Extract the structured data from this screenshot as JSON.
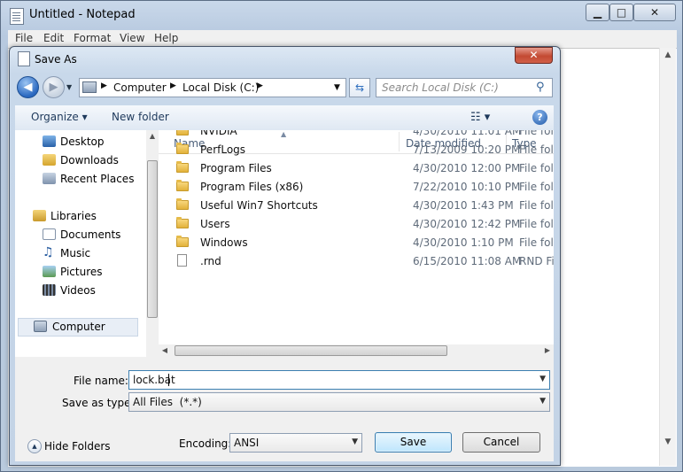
{
  "notepad": {
    "title": "Untitled - Notepad",
    "menu": [
      "File",
      "Edit",
      "Format",
      "View",
      "Help"
    ],
    "minimize": "▁",
    "maximize": "□",
    "close": "✕"
  },
  "dialog": {
    "title": "Save As",
    "close": "✕",
    "address": {
      "segments": [
        "Computer",
        "Local Disk (C:)"
      ]
    },
    "search_placeholder": "Search Local Disk (C:)",
    "toolbar": {
      "organize": "Organize ▾",
      "new_folder": "New folder",
      "help": "?"
    },
    "nav_pane": {
      "favorites": [
        "Desktop",
        "Downloads",
        "Recent Places"
      ],
      "libraries_header": "Libraries",
      "libraries": [
        "Documents",
        "Music",
        "Pictures",
        "Videos"
      ],
      "computer": "Computer"
    },
    "columns": {
      "name": "Name",
      "date_modified": "Date modified",
      "type": "Type"
    },
    "files": [
      {
        "name": "NVIDIA",
        "date": "4/30/2010 11:01 AM",
        "type": "File folder",
        "kind": "folder"
      },
      {
        "name": "PerfLogs",
        "date": "7/13/2009 10:20 PM",
        "type": "File folder",
        "kind": "folder"
      },
      {
        "name": "Program Files",
        "date": "4/30/2010 12:00 PM",
        "type": "File folder",
        "kind": "folder"
      },
      {
        "name": "Program Files (x86)",
        "date": "7/22/2010 10:10 PM",
        "type": "File folder",
        "kind": "folder"
      },
      {
        "name": "Useful Win7 Shortcuts",
        "date": "4/30/2010 1:43 PM",
        "type": "File folder",
        "kind": "folder"
      },
      {
        "name": "Users",
        "date": "4/30/2010 12:42 PM",
        "type": "File folder",
        "kind": "folder"
      },
      {
        "name": "Windows",
        "date": "4/30/2010 1:10 PM",
        "type": "File folder",
        "kind": "folder"
      },
      {
        "name": ".rnd",
        "date": "6/15/2010 11:08 AM",
        "type": "RND File",
        "kind": "file"
      }
    ],
    "file_name_label": "File name:",
    "file_name_value": "lock.bat",
    "save_as_type_label": "Save as type:",
    "save_as_type_value": "All Files  (*.*)",
    "hide_folders": "Hide Folders",
    "encoding_label": "Encoding:",
    "encoding_value": "ANSI",
    "save": "Save",
    "cancel": "Cancel"
  }
}
